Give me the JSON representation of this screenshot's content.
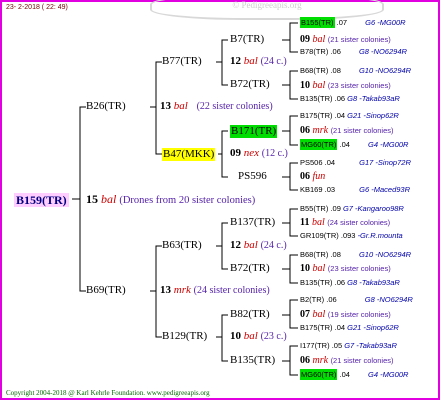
{
  "header": {
    "date": "23-  2-2018 ( 22: 49)",
    "watermark": "© Pedigreeapis.org"
  },
  "footer": {
    "copyright": "Copyright 2004-2018 @ Karl Kehrle Foundation.   www.pedigreeapis.org"
  },
  "root": {
    "id": "B159(TR)",
    "year": "15",
    "breed": "bal",
    "note": "(Drones from 20 sister colonies)"
  },
  "gen1": [
    {
      "id": "B26(TR)",
      "year": "13",
      "breed": "bal",
      "note": "(22 sister colonies)"
    },
    {
      "id": "B69(TR)",
      "year": "13",
      "breed": "mrk",
      "note": "(24 sister colonies)"
    }
  ],
  "gen2": [
    {
      "id": "B77(TR)",
      "year": "12",
      "breed": "bal",
      "note": "(24 c.)"
    },
    {
      "id": "B47(MKK)",
      "year": "09",
      "breed": "nex",
      "note": "(12 c.)"
    },
    {
      "id": "B63(TR)",
      "year": "12",
      "breed": "bal",
      "note": "(24 c.)"
    },
    {
      "id": "B129(TR)",
      "year": "10",
      "breed": "bal",
      "note": "(23 c.)"
    }
  ],
  "gen3": [
    {
      "id": "B7(TR)",
      "year": "09",
      "breed": "bal",
      "note": "(21 sister colonies)"
    },
    {
      "id": "B72(TR)",
      "year": "10",
      "breed": "bal",
      "note": "(23 sister colonies)"
    },
    {
      "id": "B171(TR)",
      "year": "06",
      "breed": "mrk",
      "note": "(21 sister colonies)"
    },
    {
      "id": "PS596",
      "year": "06",
      "breed": "fun",
      "note": ""
    },
    {
      "id": "B137(TR)",
      "year": "11",
      "breed": "bal",
      "note": "(24 sister colonies)"
    },
    {
      "id": "B72(TR)",
      "year": "10",
      "breed": "bal",
      "note": "(23 sister colonies)"
    },
    {
      "id": "B82(TR)",
      "year": "07",
      "breed": "bal",
      "note": "(19 sister colonies)"
    },
    {
      "id": "B135(TR)",
      "year": "06",
      "breed": "mrk",
      "note": "(21 sister colonies)"
    }
  ],
  "gen4": [
    {
      "id": "B155(TR)",
      "year": ".07",
      "code": "G6 -MG00R"
    },
    {
      "id": "B78(TR)",
      "year": ".06",
      "code": "G8 -NO6294R"
    },
    {
      "id": "B68(TR)",
      "year": ".08",
      "code": "G10 -NO6294R"
    },
    {
      "id": "B135(TR)",
      "year": ".06",
      "code": "G8 -Takab93aR"
    },
    {
      "id": "B175(TR)",
      "year": ".04",
      "code": "G21 -Sinop62R"
    },
    {
      "id": "MG60(TR)",
      "year": ".04",
      "code": "G4 -MG00R"
    },
    {
      "id": "PS506",
      "year": ".04",
      "code": "G17 -Sinop72R"
    },
    {
      "id": "KB169",
      "year": ".03",
      "code": "G6 -Maced93R"
    },
    {
      "id": "B55(TR)",
      "year": ".09",
      "code": "G7 -Kangaroo98R"
    },
    {
      "id": "GR109(TR)",
      "year": ".093",
      "code": "-Gr.R.mounta"
    },
    {
      "id": "B68(TR)",
      "year": ".08",
      "code": "G10 -NO6294R"
    },
    {
      "id": "B135(TR)",
      "year": ".06",
      "code": "G8 -Takab93aR"
    },
    {
      "id": "B2(TR)",
      "year": ".06",
      "code": "G8 -NO6294R"
    },
    {
      "id": "B175(TR)",
      "year": ".04",
      "code": "G21 -Sinop62R"
    },
    {
      "id": "I177(TR)",
      "year": ".05",
      "code": "G7 -Takab93aR"
    },
    {
      "id": "MG60(TR)",
      "year": ".04",
      "code": "G4 -MG00R"
    }
  ],
  "colors": {
    "frame": "#e000e0",
    "root_bg": "#ffcdff",
    "highlight_yellow": "#ffff00",
    "highlight_green": "#00dd00",
    "breed": "#cc0000",
    "sisters": "#5522aa",
    "code": "#0000aa"
  }
}
